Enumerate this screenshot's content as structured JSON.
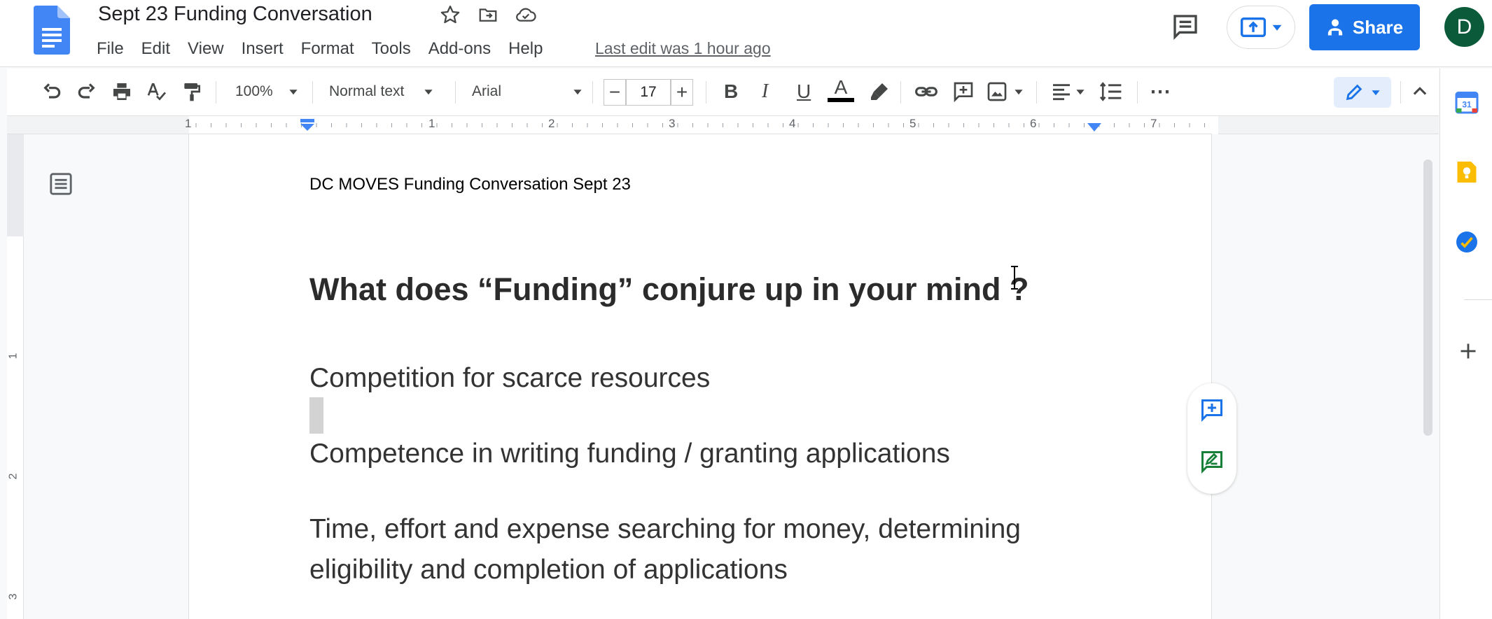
{
  "header": {
    "doc_title": "Sept 23 Funding Conversation",
    "menu": [
      "File",
      "Edit",
      "View",
      "Insert",
      "Format",
      "Tools",
      "Add-ons",
      "Help"
    ],
    "last_edit": "Last edit was 1 hour ago",
    "share_label": "Share",
    "avatar_initial": "D"
  },
  "toolbar": {
    "zoom": "100%",
    "style": "Normal text",
    "font": "Arial",
    "font_size": "17",
    "minus": "−",
    "plus": "+",
    "bold": "B",
    "italic": "I",
    "underline": "U",
    "text_color": "A",
    "more": "⋯"
  },
  "ruler": {
    "h_labels": [
      "1",
      "1",
      "2",
      "3",
      "4",
      "5",
      "6",
      "7"
    ],
    "v_labels": [
      "1",
      "2",
      "3"
    ]
  },
  "document": {
    "header_text": "DC MOVES Funding Conversation Sept 23",
    "heading": "What does “Funding” conjure up in your mind ?",
    "paragraphs": [
      "Competition for scarce resources",
      "Competence in writing funding / granting applications",
      "Time, effort and expense searching for money, determining",
      "eligibility and completion of applications"
    ]
  },
  "colors": {
    "accent": "#1a73e8",
    "avatar_bg": "#0b5a3a",
    "comment_green": "#188038"
  }
}
